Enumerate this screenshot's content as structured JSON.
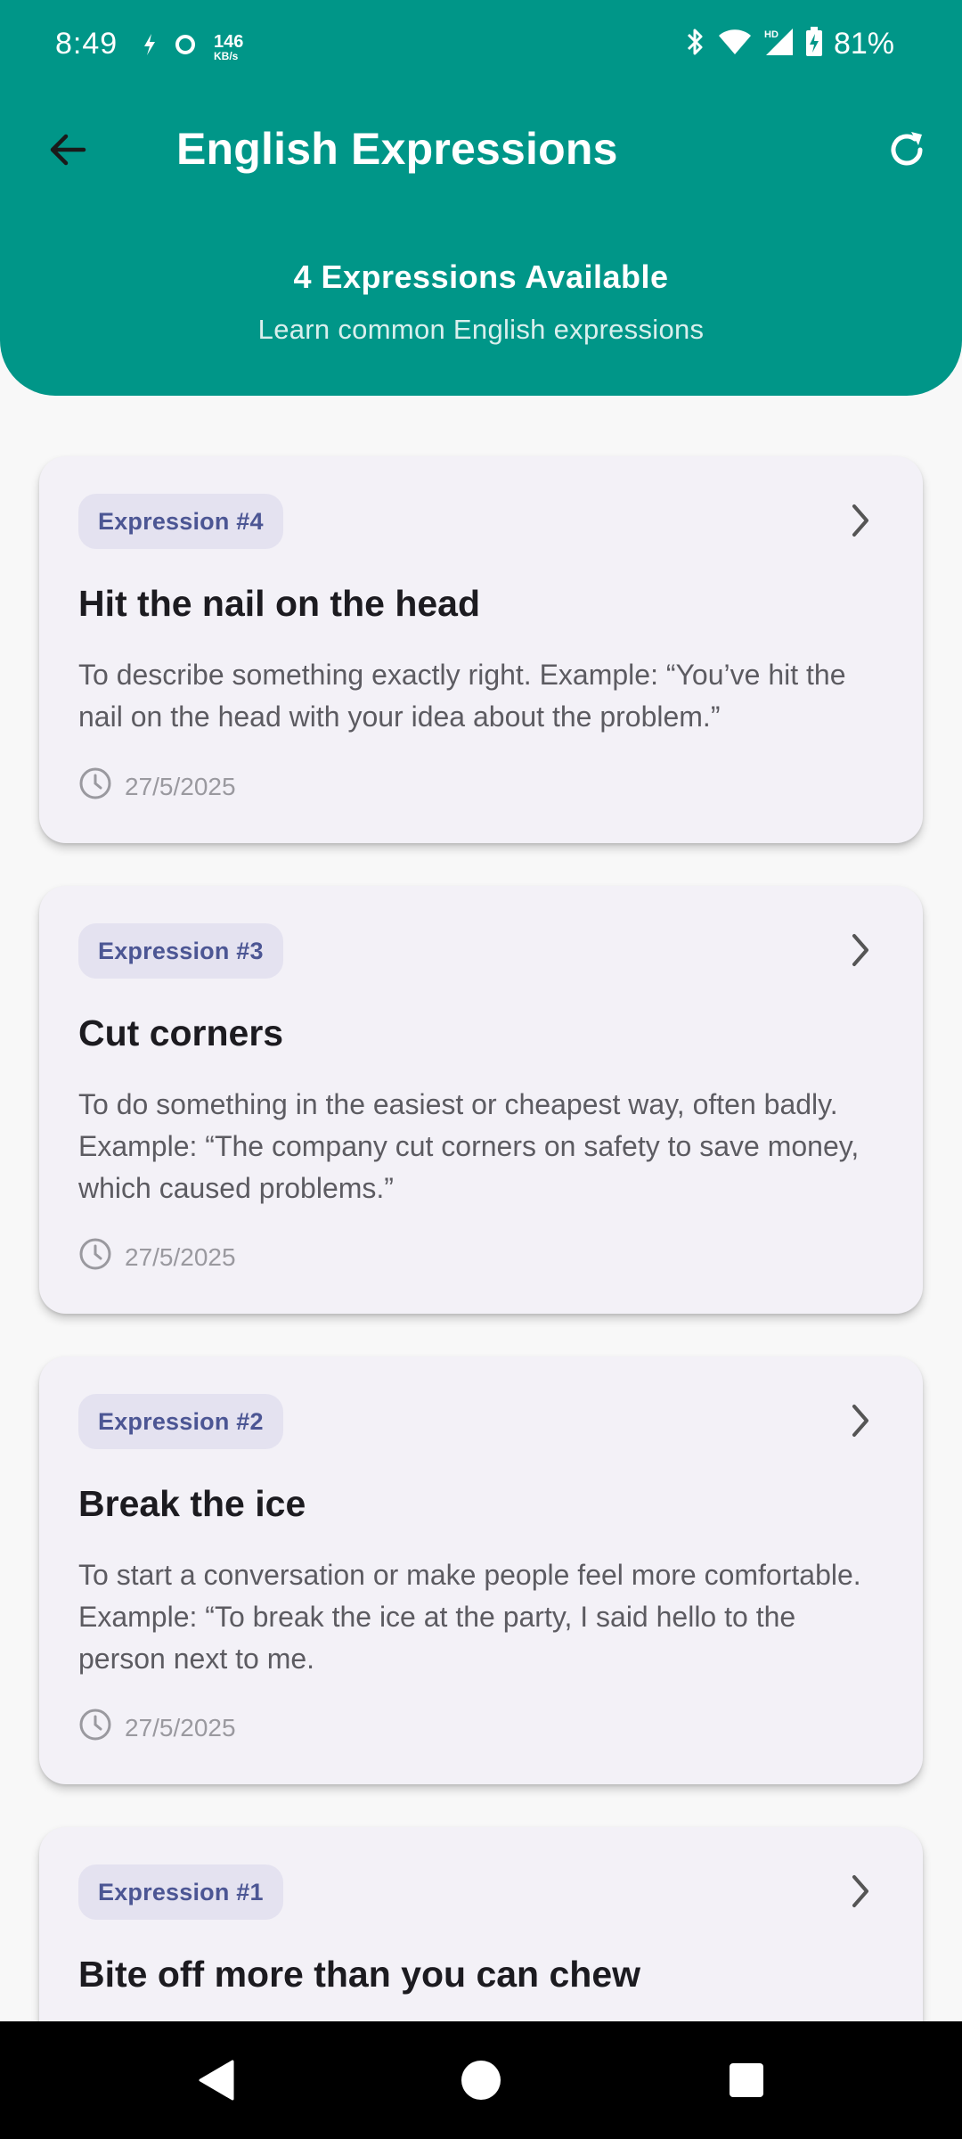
{
  "status_bar": {
    "time": "8:49",
    "net_speed_value": "146",
    "net_speed_unit": "KB/s",
    "hd_label": "HD",
    "battery": "81%"
  },
  "app_bar": {
    "title": "English Expressions"
  },
  "summary": {
    "count_text": "4 Expressions Available",
    "subtitle": "Learn common English expressions"
  },
  "expressions": [
    {
      "badge": "Expression #4",
      "title": "Hit the nail on the head",
      "description": "To describe something exactly right. Example: “You’ve hit the nail on the head with your idea about the problem.”",
      "date": "27/5/2025"
    },
    {
      "badge": "Expression #3",
      "title": "Cut corners",
      "description": "To do something in the easiest or cheapest way, often badly. Example: “The company cut corners on safety to save money, which caused problems.”",
      "date": "27/5/2025"
    },
    {
      "badge": "Expression #2",
      "title": "Break the ice",
      "description": "To start a conversation or make people feel more comfortable. Example: “To break the ice at the party, I said hello to the person next to me.",
      "date": "27/5/2025"
    },
    {
      "badge": "Expression #1",
      "title": "Bite off more than you can chew",
      "description": "",
      "date": ""
    }
  ],
  "colors": {
    "header": "#009688",
    "card": "#F3F1F7",
    "badge_bg": "#E4E2F0",
    "badge_text": "#4C5694"
  }
}
